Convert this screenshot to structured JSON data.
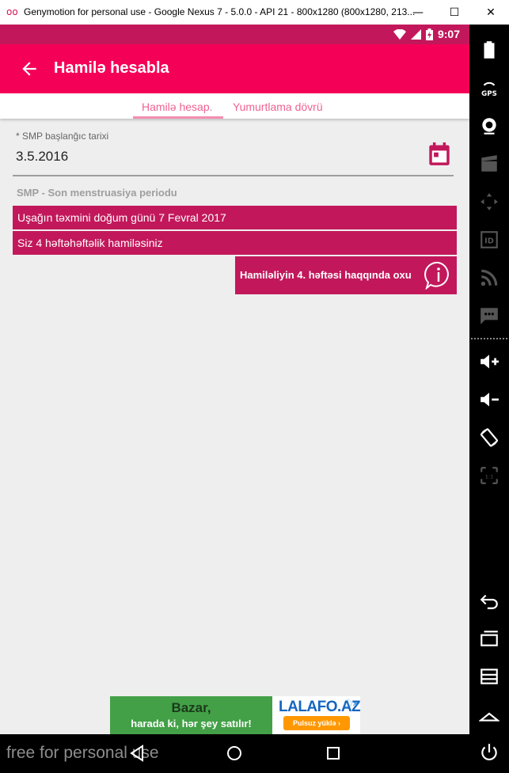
{
  "window": {
    "title": "Genymotion for personal use - Google Nexus 7 - 5.0.0 - API 21 - 800x1280 (800x1280, 213...",
    "logo_glyph": "oo",
    "minimize_glyph": "—",
    "maximize_glyph": "☐",
    "close_glyph": "✕"
  },
  "statusbar": {
    "time": "9:07"
  },
  "appbar": {
    "title": "Hamilə hesabla"
  },
  "tabs": [
    {
      "label": "Hamilə hesap.",
      "selected": true
    },
    {
      "label": "Yumurtlama dövrü",
      "selected": false
    }
  ],
  "form": {
    "date_label": "* SMP başlanğıc tarixi",
    "date_value": "3.5.2016",
    "note": "SMP - Son menstruasiya periodu"
  },
  "results": {
    "due_date": "Uşağın təxmini doğum günü 7 Fevral 2017",
    "weeks": "Siz 4 həftəhəftəlik hamiləsiniz"
  },
  "info_button": {
    "label": "Hamiləliyin 4. həftəsi haqqında oxu"
  },
  "ad": {
    "line1": "Bazar,",
    "line2": "harada ki, hər şey satılır!",
    "brand": "LALAFO.AZ",
    "cta": "Pulsuz yüklə ›",
    "close_glyph": "ⓘ✕"
  },
  "watermark": "free for personal use",
  "sidebar_icons": [
    "battery-icon",
    "gps-icon",
    "webcam-icon",
    "movie-icon",
    "dpad-icon",
    "id-icon",
    "rss-icon",
    "sms-icon",
    "volume-up-icon",
    "volume-down-icon",
    "rotate-icon",
    "fullscreen-icon",
    "back-icon",
    "recents-icon",
    "menu-icon",
    "home-icon",
    "power-icon"
  ],
  "colors": {
    "statusbar": "#c2185b",
    "appbar": "#f50057",
    "accent": "#c2185b",
    "tab_text": "#f06292"
  }
}
